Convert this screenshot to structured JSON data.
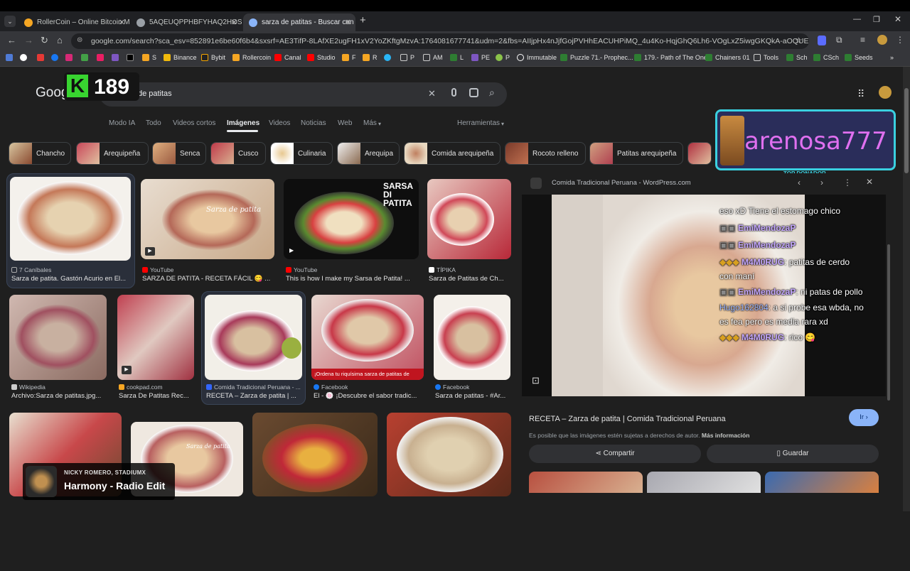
{
  "browser": {
    "tabs": [
      {
        "label": "RollerCoin – Online Bitcoin Mi...",
        "color": "#f5a623"
      },
      {
        "label": "5AQEUQPPHBFYHAQ2HOS6PV...",
        "color": "#9aa0a6"
      },
      {
        "label": "sarza de patitas - Buscar con G...",
        "color": "#8ab4f8"
      }
    ],
    "url": "google.com/search?sca_esv=852891e6be60f6b4&sxsrf=AE3TifP-8LAfXE2ugFH1xV2YoZKftgMzvA:1764081677741&udm=2&fbs=AIIjpHx4nJjfGojPVHhEACUHPiMQ_4u4Ko-HqjGhQ6Lh6-VOgLxZ5iwgGKQkA-aOQUErIB3A8R-uPBGUVf2JdeW...",
    "bookmarks": [
      "S",
      "Binance",
      "Bybit",
      "Rollercoin",
      "Canal",
      "Studio",
      "F",
      "R",
      "P",
      "AM",
      "L",
      "PE",
      "P",
      "Immutable",
      "Puzzle 71.- Prophec...",
      "179.- Path of The One",
      "Chainers 01",
      "Tools",
      "Sch",
      "CSch",
      "Seeds"
    ]
  },
  "google": {
    "logo": "Goog",
    "query": "sarza de patitas",
    "menu": [
      "Modo IA",
      "Todo",
      "Videos cortos",
      "Imágenes",
      "Videos",
      "Noticias",
      "Web",
      "Más"
    ],
    "tools": "Herramientas",
    "chips": [
      "Chancho",
      "Arequipeña",
      "Senca",
      "Cusco",
      "Culinaria",
      "Arequipa",
      "Comida arequipeña",
      "Rocoto relleno",
      "Patitas arequipeña"
    ]
  },
  "results": [
    {
      "source": "7 Caníbales",
      "title": "Sarza de patita. Gastón Acurio en El..."
    },
    {
      "source": "YouTube",
      "title": "SARZA DE PATITA - RECETA FÁCIL 😋 ..."
    },
    {
      "source": "YouTube",
      "title": "This is how I make my Sarsa de Patita! ..."
    },
    {
      "source": "TÍPIKA",
      "title": "Sarza de Patitas de Ch..."
    },
    {
      "source": "Wikipedia",
      "title": "Archivo:Sarza de patitas.jpg..."
    },
    {
      "source": "cookpad.com",
      "title": "Sarza De Patitas Rec..."
    },
    {
      "source": "Comida Tradicional Peruana - ...",
      "title": "RECETA – Zarza de patita | ..."
    },
    {
      "source": "Facebook",
      "title": "El - 🍥 ¡Descubre el sabor tradic..."
    },
    {
      "source": "Facebook",
      "title": "Sarza de patitas - #Ar..."
    }
  ],
  "overlays": {
    "counter": "189",
    "video_text": "SARSA DI PATITA",
    "img2_text": "Sarza de patita",
    "img6_text": "Sarza de patita",
    "promo_text": "¡Ordena tu riquísima sarza de patitas de"
  },
  "panel": {
    "site": "Comida Tradicional Peruana - WordPress.com",
    "site_ghost": "7 Caníbales",
    "title": "RECETA – Zarza de patita | Comida Tradicional Peruana",
    "rights": "Es posible que las imágenes estén sujetas a derechos de autor.",
    "more": "Más información",
    "visit": "Ir",
    "share": "Compartir",
    "save": "Guardar"
  },
  "stream": {
    "donor": "arenosa777",
    "donor_label": "TOP DONADOR",
    "chat": [
      {
        "user": "",
        "msg": "eso xD Tiene el estomago chico"
      },
      {
        "user": "EmiMendozaP",
        "msg": ""
      },
      {
        "user": "EmiMendozaP",
        "msg": ""
      },
      {
        "user": "M4M0RUG",
        "msg": ": patitas de cerdo"
      },
      {
        "user": "",
        "msg": "con maní"
      },
      {
        "user": "EmiMendozaP",
        "msg": ": ni patas de pollo"
      },
      {
        "user": "Hugo162804",
        "msg": ": a si probe esa wbda, no"
      },
      {
        "user": "",
        "msg": "es fea pero es media rara xd"
      },
      {
        "user": "M4M0RUG",
        "msg": ": rico 😋"
      }
    ],
    "song_artist": "NICKY ROMERO, STADIUMX",
    "song_title": "Harmony - Radio Edit"
  }
}
